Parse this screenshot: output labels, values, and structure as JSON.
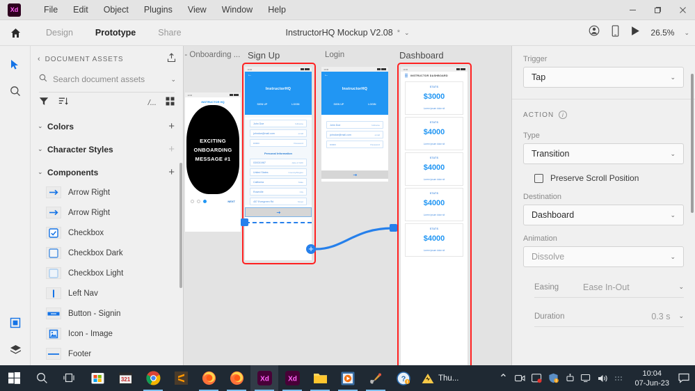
{
  "titlebar": {
    "logo": "Xd",
    "menus": [
      "File",
      "Edit",
      "Object",
      "Plugins",
      "View",
      "Window",
      "Help"
    ],
    "minimize": "—",
    "maximize": "❐",
    "close": "✕"
  },
  "toolbar": {
    "home_icon": "home-icon",
    "tabs": [
      {
        "label": "Design",
        "active": false
      },
      {
        "label": "Prototype",
        "active": true
      },
      {
        "label": "Share",
        "active": false
      }
    ],
    "document_title": "InstructorHQ Mockup V2.08",
    "unsaved_marker": "*",
    "doc_chevron": "⌄",
    "account_icon": "account-icon",
    "device_preview_icon": "device-preview-icon",
    "play_icon": "play-icon",
    "zoom_level": "26.5%",
    "zoom_chevron": "⌄"
  },
  "left_toolbar": {
    "items": [
      {
        "name": "select-tool",
        "active": true
      },
      {
        "name": "zoom-tool",
        "active": false
      },
      {
        "name": "components-panel-tool",
        "active": true
      },
      {
        "name": "layers-panel-tool",
        "active": false
      }
    ]
  },
  "assets_panel": {
    "back_chevron": "‹",
    "title": "DOCUMENT ASSETS",
    "export_icon": "export-icon",
    "search_placeholder": "Search document assets",
    "search_icon": "search-icon",
    "search_chevron": "⌄",
    "filter_icon": "filter-icon",
    "sort_icon": "sort-icon",
    "path_text": "/...",
    "grid_icon": "grid-view-icon",
    "sections": [
      {
        "caret": "⌄",
        "name": "Colors",
        "add": "+",
        "add_dim": false
      },
      {
        "caret": "⌄",
        "name": "Character Styles",
        "add": "+",
        "add_dim": true
      },
      {
        "caret": "⌄",
        "name": "Components",
        "add": "+",
        "add_dim": false
      }
    ],
    "components": [
      {
        "label": "Arrow Right",
        "icon": "arrow-right-icon"
      },
      {
        "label": "Arrow Right",
        "icon": "arrow-right-icon"
      },
      {
        "label": "Checkbox",
        "icon": "checkbox-checked-icon"
      },
      {
        "label": "Checkbox Dark",
        "icon": "checkbox-dark-icon"
      },
      {
        "label": "Checkbox Light",
        "icon": "checkbox-light-icon"
      },
      {
        "label": "Left Nav",
        "icon": "left-nav-icon"
      },
      {
        "label": "Button - Signin",
        "icon": "button-signin-icon"
      },
      {
        "label": "Icon - Image",
        "icon": "image-icon"
      },
      {
        "label": "Footer",
        "icon": "footer-icon"
      }
    ]
  },
  "canvas": {
    "artboards": [
      {
        "name": "' - Onboarding ...",
        "selected": false
      },
      {
        "name": "Sign Up",
        "selected": true
      },
      {
        "name": "Login",
        "selected": false
      },
      {
        "name": "Dashboard",
        "selected": true
      }
    ],
    "onboarding": {
      "brand": "INSTRUCTOR HQ",
      "message": "EXCITING ONBOARDING MESSAGE #1",
      "next_label": "NEXT",
      "dots": 3,
      "active_dot": 2
    },
    "signup": {
      "brand": "InstructorHQ",
      "back_icon": "back-arrow-icon",
      "tabs": [
        "SIGN UP",
        "LOGIN"
      ],
      "fields": [
        {
          "value": "John Doe",
          "label": "fullname"
        },
        {
          "value": "johndoe@mail.com",
          "label": "email"
        },
        {
          "value": "•••••••",
          "label": "Password"
        }
      ],
      "section_title": "Personal Information",
      "personal_fields": [
        {
          "value": "03/03/1987",
          "label": "date of birth"
        },
        {
          "value": "United States",
          "label": "Country/Region"
        },
        {
          "value": "California",
          "label": "State"
        },
        {
          "value": "Roseville",
          "label": "City"
        },
        {
          "value": "457 Evergreen Rd",
          "label": "Street"
        }
      ]
    },
    "login": {
      "brand": "InstructorHQ",
      "back_icon": "back-arrow-icon",
      "tabs": [
        "SIGN UP",
        "LOGIN"
      ],
      "fields": [
        {
          "value": "John Doe",
          "label": "fullname"
        },
        {
          "value": "johndoe@mail.com",
          "label": "email"
        },
        {
          "value": "•••••••",
          "label": "Password"
        }
      ]
    },
    "dashboard": {
      "header": "INSTRUCTOR DASHBOARD",
      "cards": [
        {
          "kicker": "STATS",
          "value": "$3000",
          "sub": "Lorem ipsum dolor sit"
        },
        {
          "kicker": "STATS",
          "value": "$4000",
          "sub": "Lorem ipsum dolor sit"
        },
        {
          "kicker": "STATS",
          "value": "$4000",
          "sub": "Lorem ipsum dolor sit"
        },
        {
          "kicker": "STATS",
          "value": "$4000",
          "sub": "Lorem ipsum dolor sit"
        },
        {
          "kicker": "STATS",
          "value": "$4000",
          "sub": "Lorem ipsum dolor sit"
        }
      ]
    },
    "wire": {
      "source_nub": "+",
      "accent_color": "#2680eb",
      "selection_color": "#ff2020"
    }
  },
  "properties": {
    "trigger_label": "Trigger",
    "trigger_value": "Tap",
    "action_header": "ACTION",
    "info_icon": "info-icon",
    "type_label": "Type",
    "type_value": "Transition",
    "preserve_scroll_label": "Preserve Scroll Position",
    "preserve_scroll_checked": false,
    "destination_label": "Destination",
    "destination_value": "Dashboard",
    "animation_label": "Animation",
    "animation_value": "Dissolve",
    "easing_label": "Easing",
    "easing_value": "Ease In-Out",
    "duration_label": "Duration",
    "duration_value": "0.3 s",
    "chevron": "⌄"
  },
  "taskbar": {
    "items": [
      {
        "name": "start-button",
        "glyph": "start"
      },
      {
        "name": "search-icon",
        "glyph": "search"
      },
      {
        "name": "task-view-icon",
        "glyph": "taskview"
      },
      {
        "name": "microsoft-store-icon",
        "glyph": "store"
      },
      {
        "name": "calendar-icon",
        "glyph": "calendar"
      },
      {
        "name": "chrome-icon",
        "glyph": "chrome"
      },
      {
        "name": "sublime-text-icon",
        "glyph": "sublime"
      },
      {
        "name": "firefox-icon",
        "glyph": "firefox"
      },
      {
        "name": "firefox-icon",
        "glyph": "firefox"
      },
      {
        "name": "adobe-xd-icon",
        "glyph": "xd"
      },
      {
        "name": "adobe-xd-icon",
        "glyph": "xd"
      },
      {
        "name": "file-explorer-icon",
        "glyph": "folder"
      },
      {
        "name": "media-player-icon",
        "glyph": "player"
      },
      {
        "name": "paint-icon",
        "glyph": "paint"
      },
      {
        "name": "help-icon",
        "glyph": "help"
      }
    ],
    "weather_text": "Thu...",
    "tray_chevron": "⌃",
    "time": "10:04",
    "date": "07-Jun-23",
    "notification_icon": "notification-icon"
  }
}
